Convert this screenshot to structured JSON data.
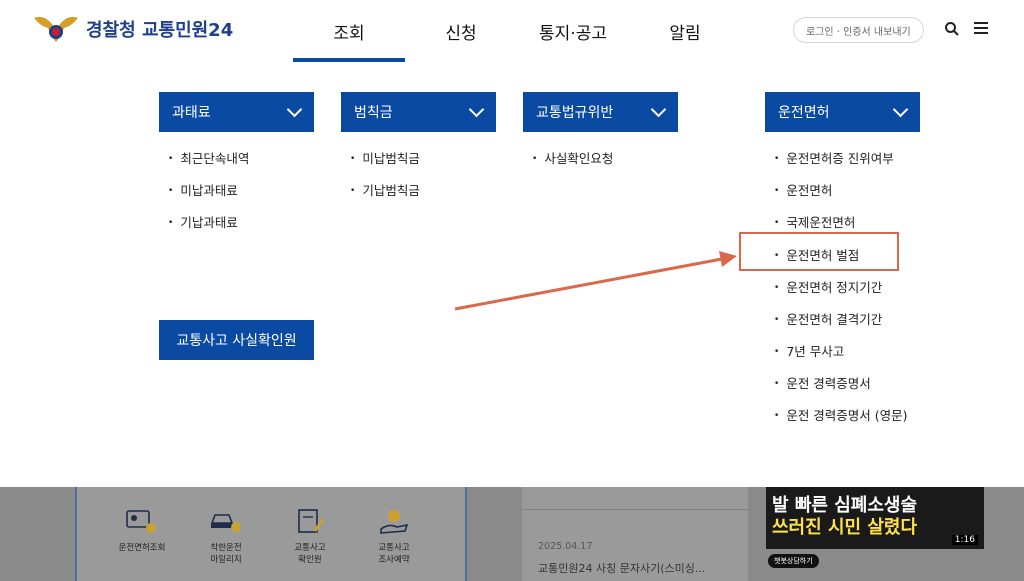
{
  "header": {
    "logo_text": "경찰청 교통민원24",
    "nav": [
      "조회",
      "신청",
      "통지·공고",
      "알림"
    ],
    "login_label": "로그인 · 인증서 내보내기"
  },
  "mega_menu": {
    "columns": [
      {
        "title": "과태료",
        "items": [
          "최근단속내역",
          "미납과태료",
          "기납과태료"
        ]
      },
      {
        "title": "범칙금",
        "items": [
          "미납범칙금",
          "기납범칙금"
        ]
      },
      {
        "title": "교통법규위반",
        "items": [
          "사실확인요청"
        ]
      },
      {
        "title": "운전면허",
        "items": [
          "운전면허증 진위여부",
          "운전면허",
          "국제운전면허",
          "운전면허 벌점",
          "운전면허 정지기간",
          "운전면허 결격기간",
          "7년 무사고",
          "운전 경력증명서",
          "운전 경력증명서 (영문)"
        ]
      }
    ],
    "extra_button": "교통사고 사실확인원"
  },
  "background": {
    "quick_links": [
      {
        "icon": "license-card-icon",
        "label": "운전면허조회"
      },
      {
        "icon": "car-coins-icon",
        "label": "착한운전\n마일리지"
      },
      {
        "icon": "document-pen-icon",
        "label": "교통사고\n확인원"
      },
      {
        "icon": "hand-reserve-icon",
        "label": "교통사고\n조사예약"
      }
    ],
    "news_date": "2025.04.17",
    "news_title": "교통민원24 사칭 문자사기(스미싱...",
    "video_text_1": "발 빠른 심폐소생술",
    "video_text_2": "쓰러진 시민 살렸다",
    "video_time": "1:16",
    "chat_badge": "챗봇상담하기"
  },
  "colors": {
    "brand_blue": "#0a4aa3",
    "highlight": "#d9694a"
  }
}
